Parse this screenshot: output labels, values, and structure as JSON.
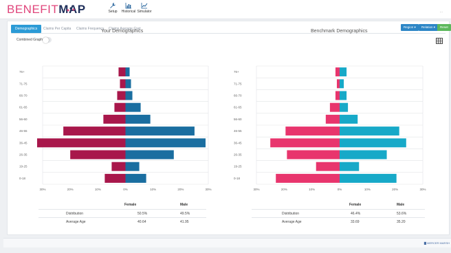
{
  "app": {
    "logo_part1": "BENEFIT",
    "logo_part2": "MAP"
  },
  "nav": [
    {
      "label": "Setup",
      "icon": "wrench-icon"
    },
    {
      "label": "Historical",
      "icon": "bar-chart-icon"
    },
    {
      "label": "Simulator",
      "icon": "line-chart-icon"
    }
  ],
  "header_right_text": "...",
  "tabs": [
    "Demographics",
    "Claims Per Capita",
    "Claims Frequency",
    "Claims Average Cost"
  ],
  "active_tab": 0,
  "buttons": {
    "region": "Region ▾",
    "relation": "Relation ▾",
    "reset": "Reset"
  },
  "toggle": {
    "label": "Combined Graph",
    "on": false
  },
  "colors": {
    "your_female": "#a8174b",
    "your_male": "#1a6ea0",
    "bench_female": "#e8356d",
    "bench_male": "#17a9c8"
  },
  "chart_data": [
    {
      "type": "bar",
      "title": "Your Demographics",
      "orientation": "horizontal",
      "categories": [
        "76+",
        "71-75",
        "66-70",
        "61-65",
        "56-60",
        "46-55",
        "36-45",
        "26-35",
        "19-25",
        "0-18"
      ],
      "series": [
        {
          "name": "Female",
          "values": [
            2.5,
            2,
            3,
            4,
            8,
            22.5,
            32,
            20,
            5,
            7.5
          ]
        },
        {
          "name": "Male",
          "values": [
            1.5,
            2,
            2.5,
            5.5,
            9,
            25,
            29,
            17.5,
            5,
            7.5
          ]
        }
      ],
      "xticks": [
        "30%",
        "20%",
        "10%",
        "0%",
        "10%",
        "20%",
        "30%"
      ],
      "xlim": [
        -30,
        30
      ]
    },
    {
      "type": "bar",
      "title": "Benchmark Demographics",
      "orientation": "horizontal",
      "categories": [
        "76+",
        "71-75",
        "66-70",
        "61-65",
        "56-60",
        "46-55",
        "36-45",
        "26-35",
        "19-25",
        "0-18"
      ],
      "series": [
        {
          "name": "Female",
          "values": [
            1.5,
            1,
            1.5,
            3.5,
            5,
            19.5,
            25,
            19,
            8.5,
            23
          ]
        },
        {
          "name": "Male",
          "values": [
            2.5,
            1.5,
            2.5,
            3,
            6.5,
            21.5,
            24,
            17,
            7,
            20.5
          ]
        }
      ],
      "xticks": [
        "30%",
        "20%",
        "10%",
        "0%",
        "10%",
        "20%",
        "30%"
      ],
      "xlim": [
        -30,
        30
      ]
    }
  ],
  "stats": [
    {
      "headers": [
        "",
        "Female",
        "Male"
      ],
      "rows": [
        {
          "label": "Distribution",
          "female": "50.5%",
          "male": "49.5%"
        },
        {
          "label": "Average Age",
          "female": "40.64",
          "male": "41.95"
        }
      ]
    },
    {
      "headers": [
        "",
        "Female",
        "Male"
      ],
      "rows": [
        {
          "label": "Distribution",
          "female": "46.4%",
          "male": "53.6%"
        },
        {
          "label": "Average Age",
          "female": "33.69",
          "male": "35.20"
        }
      ]
    }
  ],
  "footer_logo": "▇ MERCER MARSH"
}
